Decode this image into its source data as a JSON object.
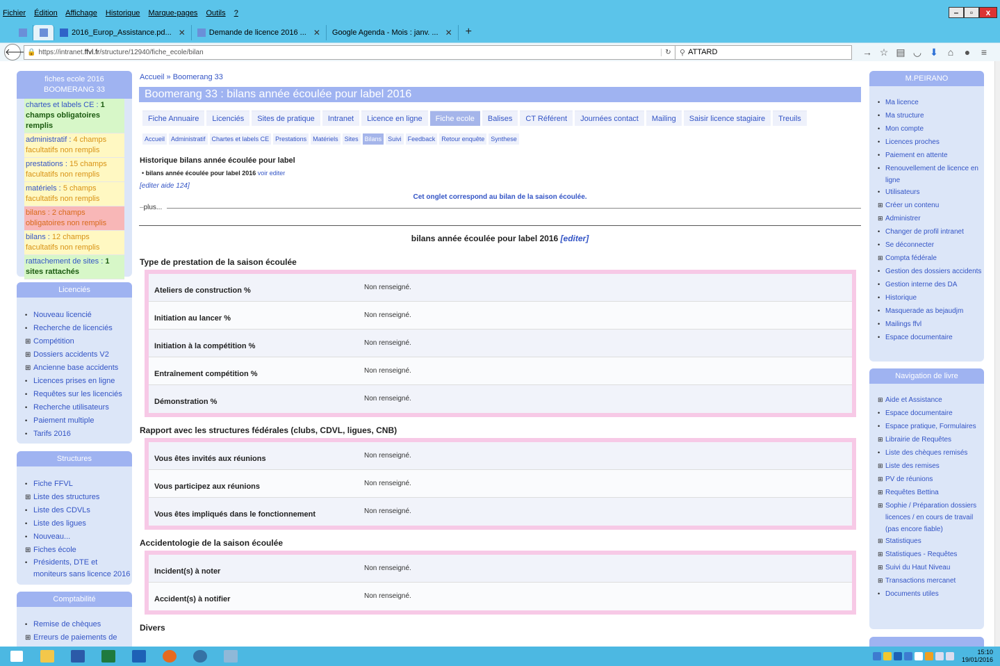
{
  "browser": {
    "menu": [
      "Fichier",
      "Édition",
      "Affichage",
      "Historique",
      "Marque-pages",
      "Outils",
      "?"
    ],
    "tabs": [
      {
        "label": "2016_Europ_Assistance.pd..."
      },
      {
        "label": "Demande de licence 2016 ..."
      },
      {
        "label": "Google Agenda - Mois : janv. ..."
      }
    ],
    "new_tab": "+",
    "url_prefix": "https://intranet.",
    "url_domain": "ffvl.fr",
    "url_path": "/structure/12940/fiche_ecole/bilan",
    "search_value": "ATTARD"
  },
  "left": {
    "fiche": {
      "title_line1": "fiches ecole 2016",
      "title_line2": "BOOMERANG 33",
      "items": [
        {
          "label": "chartes et labels CE :",
          "value": "1 champs obligatoires remplis",
          "color": "green"
        },
        {
          "label": "administratif :",
          "value": "4 champs facultatifs non remplis",
          "color": "yellow"
        },
        {
          "label": "prestations :",
          "value": "15 champs facultatifs non remplis",
          "color": "yellow"
        },
        {
          "label": "matériels :",
          "value": "5 champs facultatifs non remplis",
          "color": "yellow"
        },
        {
          "label": "bilans :",
          "value": "2 champs obligatoires non remplis",
          "color": "red"
        },
        {
          "label": "bilans :",
          "value": "12 champs facultatifs non remplis",
          "color": "yellow"
        },
        {
          "label": "rattachement de sites :",
          "value": "1 sites rattachés",
          "color": "green"
        }
      ]
    },
    "licencies": {
      "title": "Licenciés",
      "items": [
        "Nouveau licencié",
        "Recherche de licenciés",
        "Compétition",
        "Dossiers accidents V2",
        "Ancienne base accidents",
        "Licences prises en ligne",
        "Requêtes sur les licenciés",
        "Recherche utilisateurs",
        "Paiement multiple",
        "Tarifs 2016"
      ]
    },
    "structures": {
      "title": "Structures",
      "items": [
        "Fiche FFVL",
        "Liste des structures",
        "Liste des CDVLs",
        "Liste des ligues",
        "Nouveau...",
        "Fiches école",
        "Présidents, DTE et moniteurs sans licence 2016"
      ]
    },
    "comptabilite": {
      "title": "Comptabilité",
      "items": [
        "Remise de chèques",
        "Erreurs de paiements de"
      ]
    }
  },
  "main": {
    "breadcrumb": "Accueil » Boomerang 33",
    "title": "Boomerang 33 : bilans année écoulée pour label 2016",
    "tabs": [
      "Fiche Annuaire",
      "Licenciés",
      "Sites de pratique",
      "Intranet",
      "Licence en ligne",
      "Fiche ecole",
      "Balises",
      "CT Référent",
      "Journées contact",
      "Mailing",
      "Saisir licence stagiaire",
      "Treuils"
    ],
    "subtabs": [
      "Accueil",
      "Administratif",
      "Chartes et labels CE",
      "Prestations",
      "Matériels",
      "Sites",
      "Bilans",
      "Suivi",
      "Feedback",
      "Retour enquête",
      "Synthese"
    ],
    "history_title": "Historique bilans année écoulée pour label",
    "history_item": "bilans année écoulée pour label 2016",
    "history_links": "voir editer",
    "aide": "[editer aide 124]",
    "info": "Cet onglet correspond au bilan de la saison écoulée.",
    "plus": "plus...",
    "bilan_title": "bilans année écoulée pour label 2016",
    "bilan_edit": "[editer]",
    "sections": [
      {
        "title": "Type de prestation de la saison écoulée",
        "rows": [
          {
            "k": "Ateliers de construction %",
            "v": "Non renseigné."
          },
          {
            "k": "Initiation au lancer %",
            "v": "Non renseigné."
          },
          {
            "k": "Initiation à la compétition %",
            "v": "Non renseigné."
          },
          {
            "k": "Entraînement compétition %",
            "v": "Non renseigné."
          },
          {
            "k": "Démonstration %",
            "v": "Non renseigné."
          }
        ]
      },
      {
        "title": "Rapport avec les structures fédérales (clubs, CDVL, ligues, CNB)",
        "rows": [
          {
            "k": "Vous êtes invités aux réunions",
            "v": "Non renseigné."
          },
          {
            "k": "Vous participez aux réunions",
            "v": "Non renseigné."
          },
          {
            "k": "Vous êtes impliqués dans le fonctionnement",
            "v": "Non renseigné."
          }
        ]
      },
      {
        "title": "Accidentologie de la saison écoulée",
        "rows": [
          {
            "k": "Incident(s) à noter",
            "v": "Non renseigné."
          },
          {
            "k": "Accident(s) à notifier",
            "v": "Non renseigné."
          }
        ]
      },
      {
        "title": "Divers",
        "rows": []
      }
    ]
  },
  "right": {
    "user": {
      "title": "M.PEIRANO",
      "items": [
        {
          "label": "Ma licence",
          "type": "leaf"
        },
        {
          "label": "Ma structure",
          "type": "leaf"
        },
        {
          "label": "Mon compte",
          "type": "leaf"
        },
        {
          "label": "Licences proches",
          "type": "leaf"
        },
        {
          "label": "Paiement en attente",
          "type": "leaf"
        },
        {
          "label": "Renouvellement de licence en ligne",
          "type": "leaf"
        },
        {
          "label": "Utilisateurs",
          "type": "leaf"
        },
        {
          "label": "Créer un contenu",
          "type": "plus"
        },
        {
          "label": "Administrer",
          "type": "plus"
        },
        {
          "label": "Changer de profil intranet",
          "type": "leaf"
        },
        {
          "label": "Se déconnecter",
          "type": "leaf"
        },
        {
          "label": "Compta fédérale",
          "type": "plus"
        },
        {
          "label": "Gestion des dossiers accidents",
          "type": "leaf"
        },
        {
          "label": "Gestion interne des DA",
          "type": "leaf"
        },
        {
          "label": "Historique",
          "type": "leaf"
        },
        {
          "label": "Masquerade as bejaudjm",
          "type": "leaf"
        },
        {
          "label": "Mailings ffvl",
          "type": "leaf"
        },
        {
          "label": "Espace documentaire",
          "type": "leaf"
        }
      ]
    },
    "livre": {
      "title": "Navigation de livre",
      "items": [
        {
          "label": "Aide et Assistance",
          "type": "plus"
        },
        {
          "label": "Espace documentaire",
          "type": "leaf"
        },
        {
          "label": "Espace pratique, Formulaires",
          "type": "leaf"
        },
        {
          "label": "Librairie de Requêtes",
          "type": "plus"
        },
        {
          "label": "Liste des chèques remisés",
          "type": "leaf"
        },
        {
          "label": "Liste des remises",
          "type": "plus"
        },
        {
          "label": "PV de réunions",
          "type": "plus"
        },
        {
          "label": "Requêtes Bettina",
          "type": "plus"
        },
        {
          "label": "Sophie / Préparation dossiers licences / en cours de travail (pas encore fiable)",
          "type": "plus"
        },
        {
          "label": "Statistiques",
          "type": "plus"
        },
        {
          "label": "Statistiques - Requêtes",
          "type": "plus"
        },
        {
          "label": "Suivi du Haut Niveau",
          "type": "plus"
        },
        {
          "label": "Transactions mercanet",
          "type": "plus"
        },
        {
          "label": "Documents utiles",
          "type": "leaf"
        }
      ]
    }
  },
  "taskbar": {
    "time": "15:10",
    "date": "19/01/2016"
  },
  "colors": {
    "chrome": "#5bc4ea",
    "block_head": "#9fb3f1",
    "block_body": "#dce6f8",
    "link": "#3354c5",
    "group_border": "#f7c9e6"
  }
}
